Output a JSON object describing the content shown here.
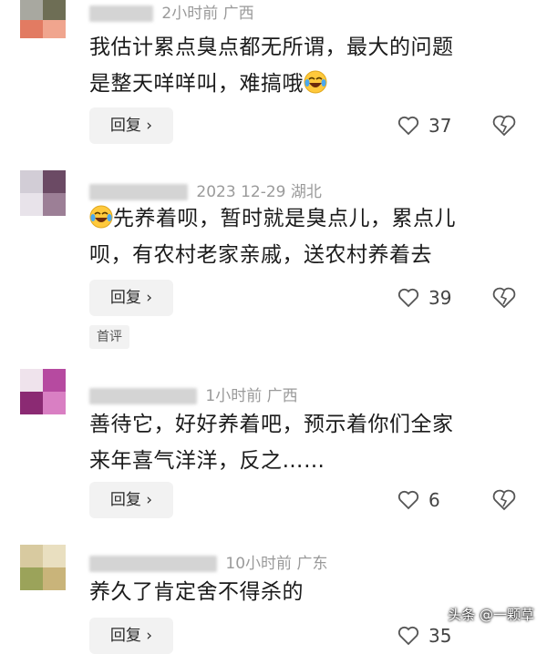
{
  "comments": [
    {
      "meta_time": "2小时前",
      "meta_region": "广西",
      "text_lines": [
        "我估计累点臭点都无所谓，最大的问题",
        "是整天咩咩叫，难搞哦"
      ],
      "reply_label": "回复",
      "likes": "37"
    },
    {
      "meta_time": "2023 12-29",
      "meta_region": "湖北",
      "text_lines": [
        "先养着呗，暂时就是臭点儿，累点儿",
        "呗，有农村老家亲戚，送农村养着去"
      ],
      "reply_label": "回复",
      "likes": "39",
      "tag": "首评"
    },
    {
      "meta_time": "1小时前",
      "meta_region": "广西",
      "text_lines": [
        "善待它，好好养着吧，预示着你们全家",
        "来年喜气洋洋，反之……"
      ],
      "reply_label": "回复",
      "likes": "6"
    },
    {
      "meta_time": "10小时前",
      "meta_region": "广东",
      "text_lines": [
        "养久了肯定舍不得杀的"
      ],
      "reply_label": "回复",
      "likes": "35"
    }
  ],
  "watermark": "头条 @一颗草",
  "icons": {
    "like": "heart-outline-icon",
    "dislike": "broken-heart-icon",
    "emoji": "laughing-crying-emoji-icon",
    "reply_chevron": "chevron-right-icon"
  },
  "colors": {
    "text": "#1b1b1b",
    "meta": "#9a9a9a",
    "reply_bg": "#f2f2f2"
  }
}
